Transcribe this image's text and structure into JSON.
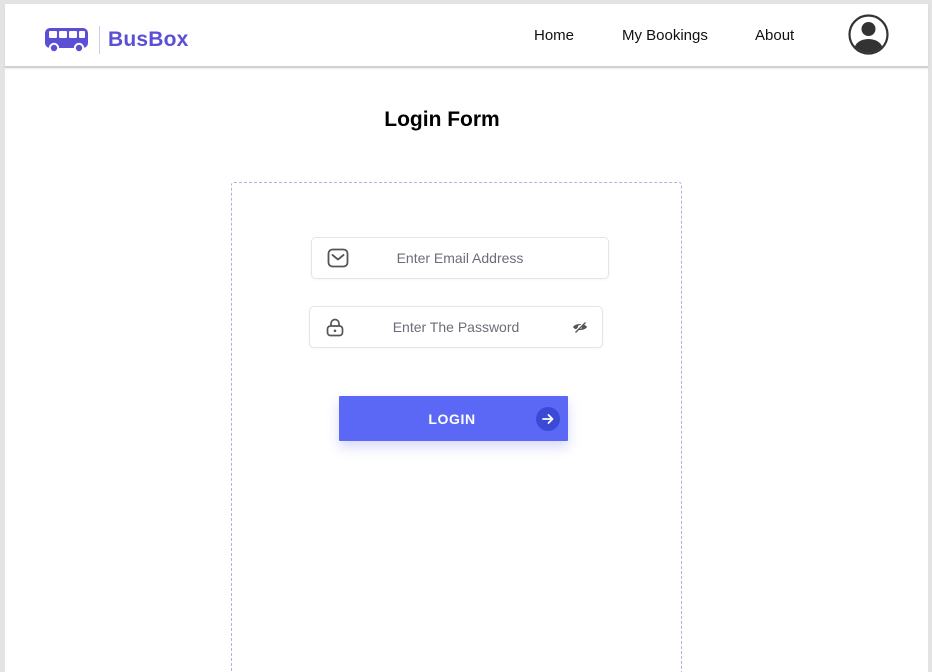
{
  "app": {
    "brand": "BusBox",
    "brand_color": "#5b4fd6",
    "accent_color": "#5b68f5"
  },
  "header": {
    "logo_icon": "bus-icon",
    "nav": [
      {
        "label": "Home"
      },
      {
        "label": "My Bookings"
      },
      {
        "label": "About"
      }
    ],
    "profile_icon": "user-avatar-icon"
  },
  "main": {
    "title": "Login Form",
    "email": {
      "placeholder": "Enter Email Address",
      "value": "",
      "icon": "mail-icon"
    },
    "password": {
      "placeholder": "Enter The Password",
      "value": "",
      "icon": "lock-icon",
      "toggle_icon": "eye-off-icon"
    },
    "login_button": {
      "label": "LOGIN",
      "icon": "arrow-right-icon"
    }
  }
}
